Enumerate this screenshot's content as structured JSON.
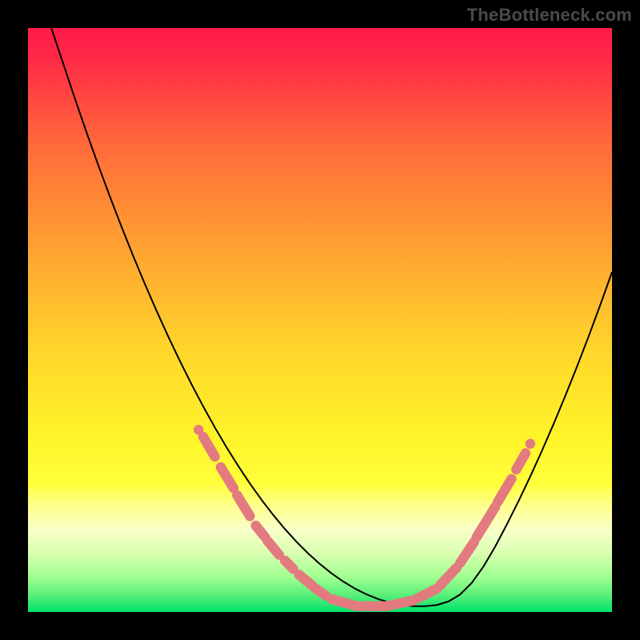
{
  "watermark": "TheBottleneck.com",
  "chart_data": {
    "type": "line",
    "title": "",
    "xlabel": "",
    "ylabel": "",
    "xlim": [
      0,
      1
    ],
    "ylim": [
      0,
      1
    ],
    "background_gradient": {
      "stops": [
        {
          "offset": 0.0,
          "color": "#ff1a49"
        },
        {
          "offset": 0.05,
          "color": "#ff2946"
        },
        {
          "offset": 0.2,
          "color": "#ff6a3a"
        },
        {
          "offset": 0.35,
          "color": "#ff9a33"
        },
        {
          "offset": 0.55,
          "color": "#ffd52b"
        },
        {
          "offset": 0.7,
          "color": "#fff429"
        },
        {
          "offset": 0.78,
          "color": "#ffff3a"
        },
        {
          "offset": 0.82,
          "color": "#ffff90"
        },
        {
          "offset": 0.86,
          "color": "#f8ffc8"
        },
        {
          "offset": 0.9,
          "color": "#d8ffb0"
        },
        {
          "offset": 0.94,
          "color": "#9fff90"
        },
        {
          "offset": 0.97,
          "color": "#5cf07a"
        },
        {
          "offset": 1.0,
          "color": "#00e26a"
        }
      ]
    },
    "series": [
      {
        "name": "curve",
        "color": "#000000",
        "x": [
          0.04,
          0.06,
          0.08,
          0.1,
          0.12,
          0.14,
          0.16,
          0.18,
          0.2,
          0.22,
          0.24,
          0.26,
          0.28,
          0.3,
          0.32,
          0.34,
          0.36,
          0.38,
          0.4,
          0.42,
          0.44,
          0.46,
          0.48,
          0.5,
          0.52,
          0.54,
          0.56,
          0.58,
          0.6,
          0.62,
          0.64,
          0.66,
          0.68,
          0.7,
          0.72,
          0.74,
          0.76,
          0.78,
          0.8,
          0.82,
          0.84,
          0.86,
          0.88,
          0.9,
          0.92,
          0.94,
          0.96,
          0.98,
          1.0
        ],
        "y": [
          1.0,
          0.94,
          0.88,
          0.822,
          0.766,
          0.712,
          0.66,
          0.61,
          0.562,
          0.516,
          0.472,
          0.43,
          0.39,
          0.352,
          0.316,
          0.282,
          0.25,
          0.22,
          0.192,
          0.166,
          0.142,
          0.12,
          0.1,
          0.082,
          0.066,
          0.052,
          0.04,
          0.03,
          0.022,
          0.016,
          0.012,
          0.01,
          0.01,
          0.012,
          0.018,
          0.03,
          0.05,
          0.078,
          0.112,
          0.15,
          0.19,
          0.232,
          0.276,
          0.322,
          0.37,
          0.42,
          0.472,
          0.526,
          0.582
        ]
      }
    ],
    "markers": {
      "name": "pink-markers",
      "color": "#e37a80",
      "radius_norm": 0.0085,
      "notch_segments": [
        {
          "x0": 0.3,
          "y0": 0.3,
          "x1": 0.32,
          "y1": 0.266
        },
        {
          "x0": 0.33,
          "y0": 0.248,
          "x1": 0.352,
          "y1": 0.212
        },
        {
          "x0": 0.358,
          "y0": 0.2,
          "x1": 0.38,
          "y1": 0.164
        },
        {
          "x0": 0.39,
          "y0": 0.148,
          "x1": 0.406,
          "y1": 0.128
        },
        {
          "x0": 0.41,
          "y0": 0.122,
          "x1": 0.43,
          "y1": 0.098
        },
        {
          "x0": 0.44,
          "y0": 0.088,
          "x1": 0.454,
          "y1": 0.074
        },
        {
          "x0": 0.464,
          "y0": 0.064,
          "x1": 0.486,
          "y1": 0.046
        },
        {
          "x0": 0.49,
          "y0": 0.042,
          "x1": 0.51,
          "y1": 0.028
        },
        {
          "x0": 0.52,
          "y0": 0.022,
          "x1": 0.556,
          "y1": 0.012
        },
        {
          "x0": 0.562,
          "y0": 0.01,
          "x1": 0.61,
          "y1": 0.01
        },
        {
          "x0": 0.614,
          "y0": 0.01,
          "x1": 0.66,
          "y1": 0.02
        },
        {
          "x0": 0.668,
          "y0": 0.024,
          "x1": 0.7,
          "y1": 0.04
        },
        {
          "x0": 0.706,
          "y0": 0.046,
          "x1": 0.734,
          "y1": 0.076
        },
        {
          "x0": 0.74,
          "y0": 0.084,
          "x1": 0.764,
          "y1": 0.12
        },
        {
          "x0": 0.768,
          "y0": 0.128,
          "x1": 0.8,
          "y1": 0.18
        },
        {
          "x0": 0.804,
          "y0": 0.188,
          "x1": 0.828,
          "y1": 0.228
        },
        {
          "x0": 0.836,
          "y0": 0.244,
          "x1": 0.852,
          "y1": 0.272
        }
      ],
      "end_dots": [
        {
          "x": 0.292,
          "y": 0.312
        },
        {
          "x": 0.86,
          "y": 0.288
        }
      ]
    }
  }
}
